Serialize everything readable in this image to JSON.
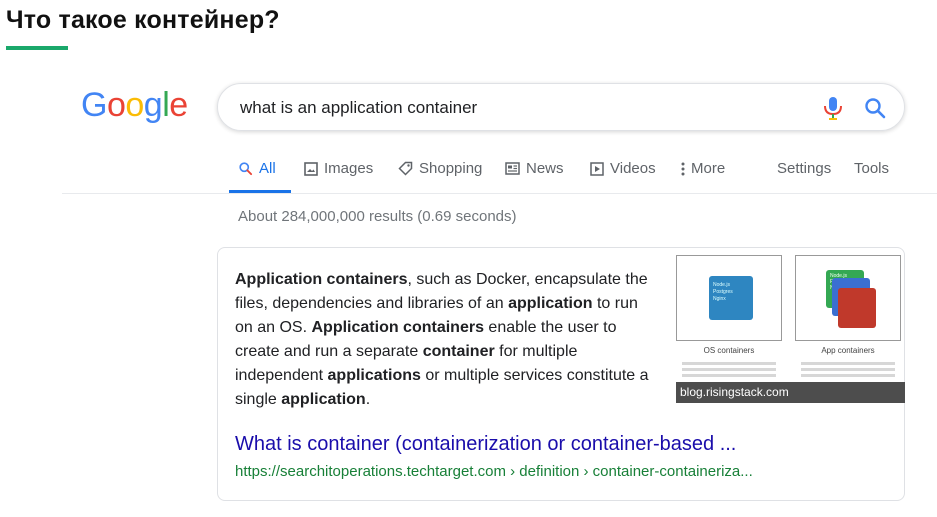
{
  "slide": {
    "title": "Что такое контейнер?"
  },
  "logo": {
    "letters": [
      "G",
      "o",
      "o",
      "g",
      "l",
      "e"
    ],
    "colors": [
      "#4285F4",
      "#EA4335",
      "#FBBC05",
      "#4285F4",
      "#34A853",
      "#EA4335"
    ]
  },
  "search": {
    "query": "what is an application container"
  },
  "tabs": {
    "all": "All",
    "images": "Images",
    "shopping": "Shopping",
    "news": "News",
    "videos": "Videos",
    "more": "More",
    "settings": "Settings",
    "tools": "Tools"
  },
  "results": {
    "stats": "About 284,000,000 results (0.69 seconds)"
  },
  "featured_snippet": {
    "segments": [
      {
        "text": "Application containers",
        "bold": true
      },
      {
        "text": ", such as Docker, encapsulate the files, dependencies and libraries of an ",
        "bold": false
      },
      {
        "text": "application",
        "bold": true
      },
      {
        "text": " to run on an OS. ",
        "bold": false
      },
      {
        "text": "Application containers",
        "bold": true
      },
      {
        "text": " enable the user to create and run a separate ",
        "bold": false
      },
      {
        "text": "container",
        "bold": true
      },
      {
        "text": " for multiple independent ",
        "bold": false
      },
      {
        "text": "applications",
        "bold": true
      },
      {
        "text": " or multiple services constitute a single ",
        "bold": false
      },
      {
        "text": "application",
        "bold": true
      },
      {
        "text": ".",
        "bold": false
      }
    ],
    "image": {
      "left_caption": "OS containers",
      "right_caption": "App containers",
      "box_labels": [
        "Node.js",
        "Postgres",
        "Nginx"
      ],
      "source": "blog.risingstack.com"
    },
    "link_title": "What is container (containerization or container-based ...",
    "url": "https://searchitoperations.techtarget.com › definition › container-containeriza..."
  },
  "colors": {
    "accent": "#1a73e8",
    "link": "#1a0dab",
    "url": "#188038",
    "title_underline": "#1aa86b"
  }
}
